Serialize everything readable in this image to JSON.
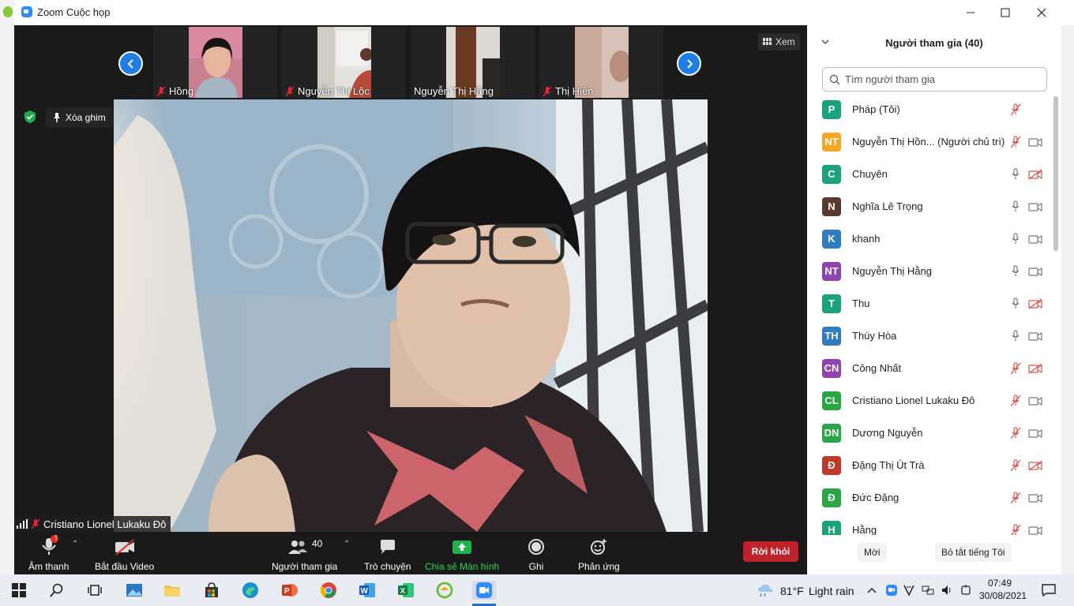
{
  "window": {
    "title": "Zoom Cuộc họp"
  },
  "strip": {
    "participants": [
      {
        "name": "Hồng"
      },
      {
        "name": "Nguyễn Thị Lộc"
      },
      {
        "name": "Nguyễn Thị Hằng"
      },
      {
        "name": "Thị Hiền"
      }
    ],
    "view_label": "Xem"
  },
  "main": {
    "unpin_label": "Xóa ghim",
    "speaker_name": "Cristiano Lionel Lukaku Đô"
  },
  "toolbar": {
    "audio_label": "Âm thanh",
    "audio_alert": "!",
    "video_label": "Bắt đầu Video",
    "participants_label": "Người tham gia",
    "participants_count": "40",
    "chat_label": "Trò chuyện",
    "share_label": "Chia sẻ Màn hình",
    "record_label": "Ghi",
    "reactions_label": "Phản ứng",
    "leave_label": "Rời khỏi"
  },
  "panel": {
    "title": "Người tham gia (40)",
    "search_placeholder": "Tìm người tham gia",
    "participants": [
      {
        "initials": "P",
        "name": "Pháp (Tôi)",
        "color": "#1aa37a",
        "mic": "muted",
        "video": "none"
      },
      {
        "initials": "NT",
        "name": "Nguyễn Thị Hồn...  (Người chủ trì)",
        "color": "#f5a623",
        "mic": "muted",
        "video": "on"
      },
      {
        "initials": "C",
        "name": "Chuyên",
        "color": "#1aa37a",
        "mic": "on",
        "video": "off"
      },
      {
        "initials": "N",
        "name": "Nghĩa Lê Trọng",
        "color": "#5a3a2e",
        "mic": "on",
        "video": "on"
      },
      {
        "initials": "K",
        "name": "khanh",
        "color": "#2f7cc1",
        "mic": "on",
        "video": "on"
      },
      {
        "initials": "NT",
        "name": "Nguyễn Thị Hằng",
        "color": "#8e44ad",
        "mic": "on",
        "video": "on"
      },
      {
        "initials": "T",
        "name": "Thu",
        "color": "#1aa37a",
        "mic": "on",
        "video": "off"
      },
      {
        "initials": "TH",
        "name": "Thúy Hòa",
        "color": "#2f7cc1",
        "mic": "on",
        "video": "on"
      },
      {
        "initials": "CN",
        "name": "Công Nhất",
        "color": "#8e44ad",
        "mic": "muted",
        "video": "off"
      },
      {
        "initials": "CL",
        "name": "Cristiano Lionel Lukaku Đô",
        "color": "#27a844",
        "mic": "muted",
        "video": "on"
      },
      {
        "initials": "DN",
        "name": "Dương Nguyễn",
        "color": "#27a844",
        "mic": "muted",
        "video": "on"
      },
      {
        "initials": "Đ",
        "name": "Đặng Thị Út Trà",
        "color": "#c0392b",
        "mic": "muted",
        "video": "off"
      },
      {
        "initials": "Đ",
        "name": "Đức Đặng",
        "color": "#27a844",
        "mic": "muted",
        "video": "on"
      },
      {
        "initials": "H",
        "name": "Hằng",
        "color": "#1aa37a",
        "mic": "muted",
        "video": "on"
      }
    ],
    "invite_label": "Mời",
    "mute_all_label": "Bỏ tắt tiếng Tôi"
  },
  "taskbar": {
    "weather_temp": "81°F",
    "weather_text": "Light rain",
    "time": "07:49",
    "date": "30/08/2021"
  }
}
